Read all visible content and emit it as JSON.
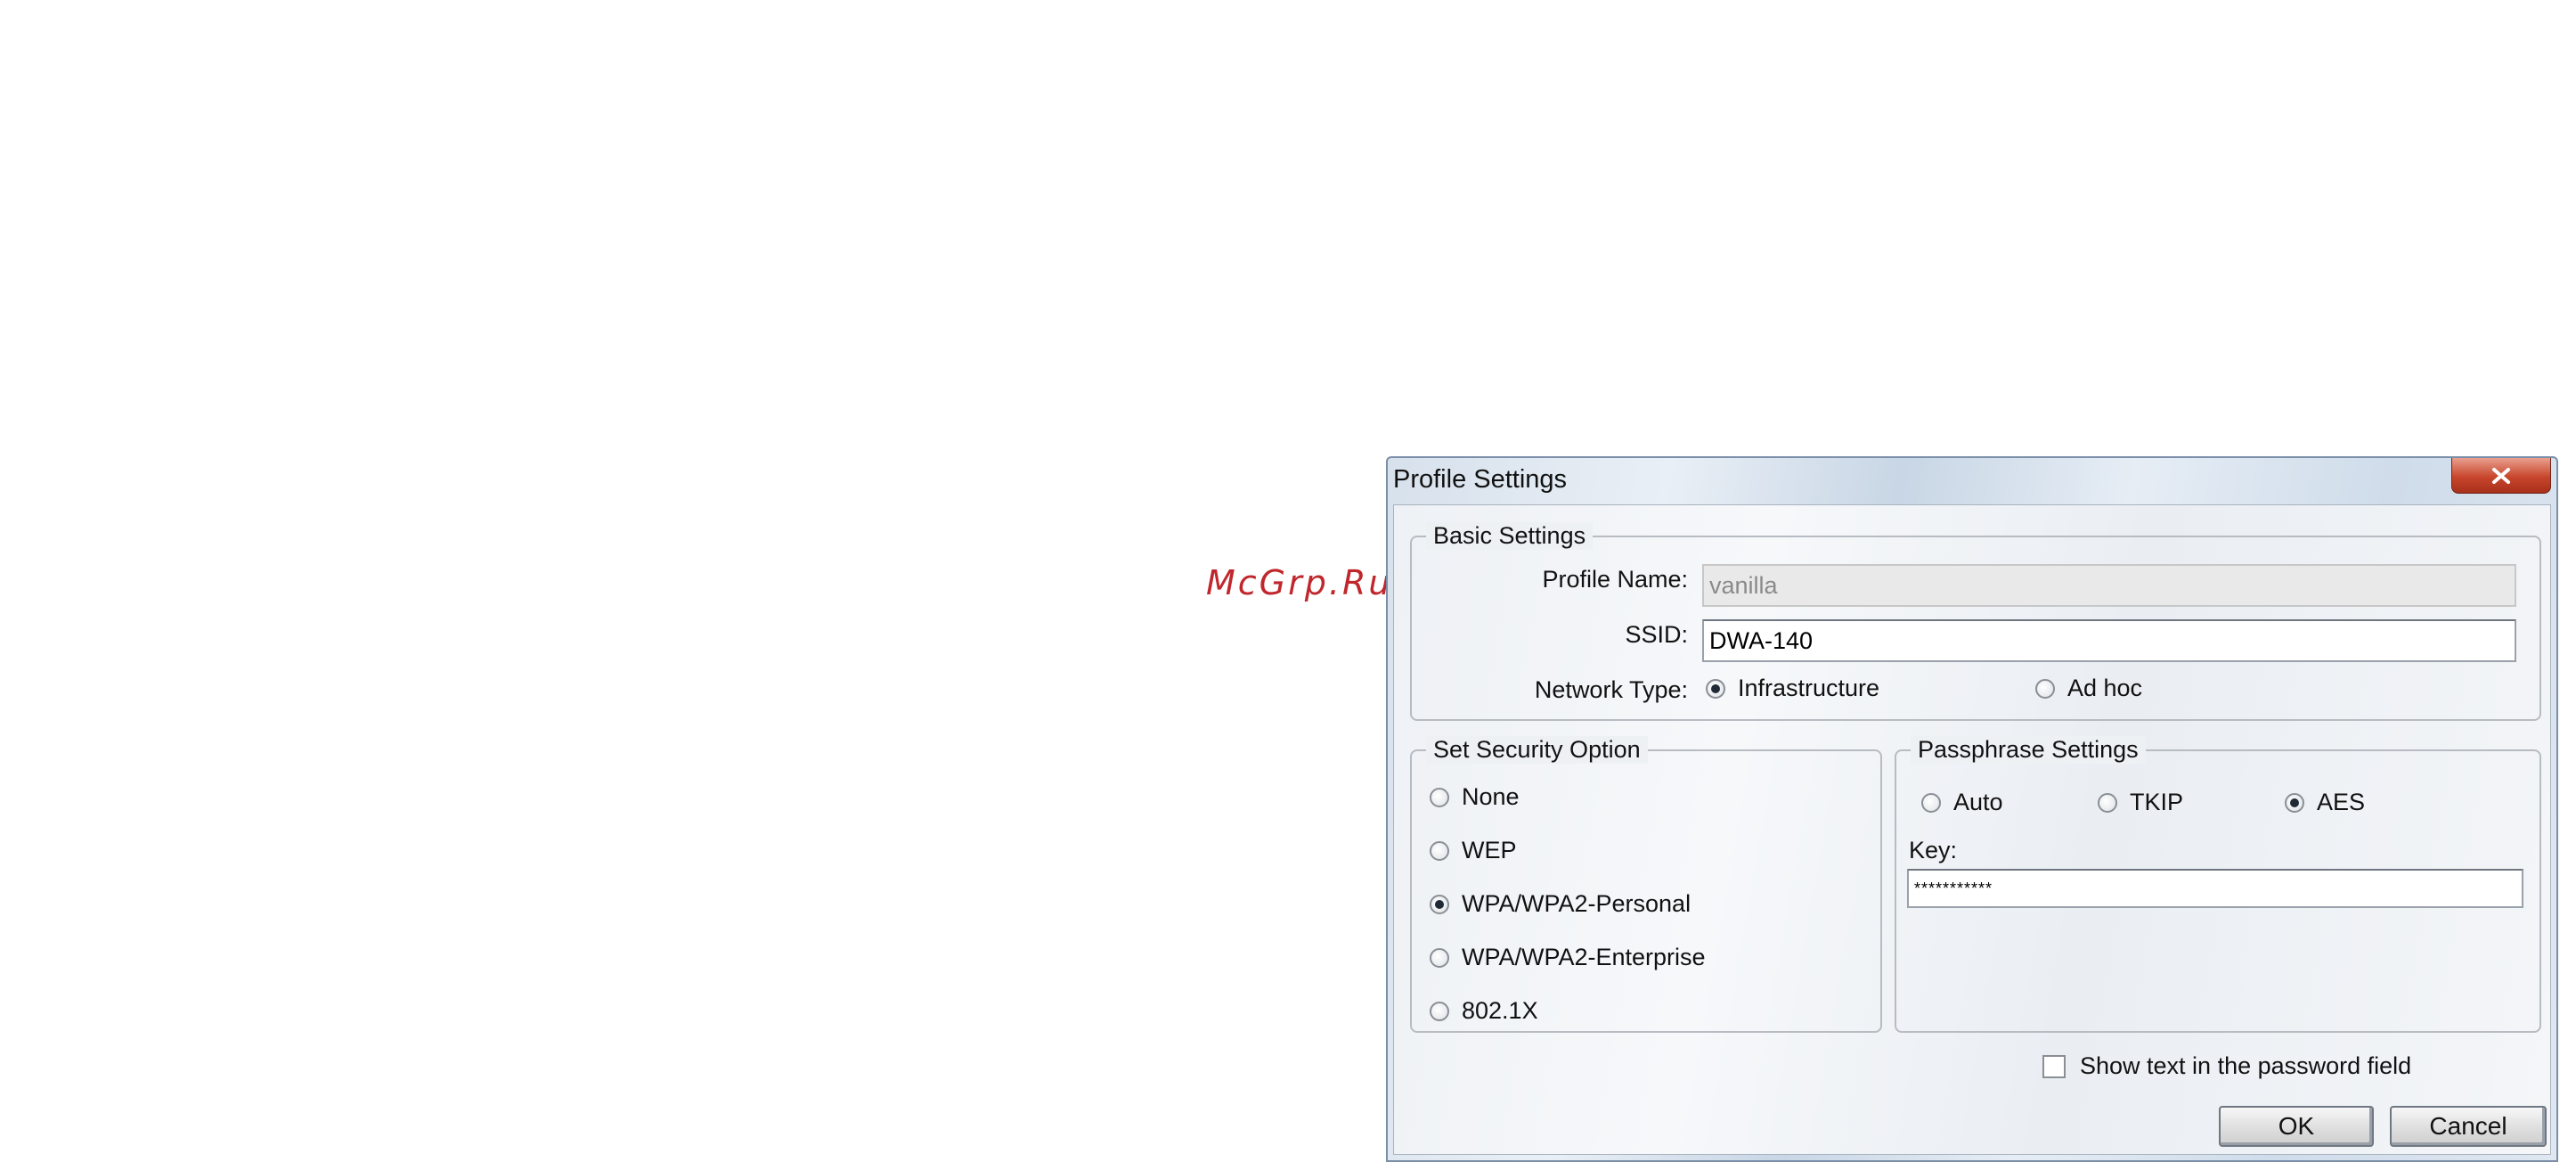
{
  "watermark": "McGrp.Ru",
  "window": {
    "title": "Profile Settings"
  },
  "basic": {
    "group_label": "Basic Settings",
    "profile_name_label": "Profile Name:",
    "profile_name_value": "vanilla",
    "ssid_label": "SSID:",
    "ssid_value": "DWA-140",
    "network_type_label": "Network Type:",
    "network_types": [
      {
        "label": "Infrastructure",
        "checked": true
      },
      {
        "label": "Ad hoc",
        "checked": false
      }
    ]
  },
  "security": {
    "group_label": "Set Security Option",
    "options": [
      {
        "label": "None",
        "checked": false
      },
      {
        "label": "WEP",
        "checked": false
      },
      {
        "label": "WPA/WPA2-Personal",
        "checked": true
      },
      {
        "label": "WPA/WPA2-Enterprise",
        "checked": false
      },
      {
        "label": "802.1X",
        "checked": false
      }
    ]
  },
  "passphrase": {
    "group_label": "Passphrase Settings",
    "ciphers": [
      {
        "label": "Auto",
        "checked": false
      },
      {
        "label": "TKIP",
        "checked": false
      },
      {
        "label": "AES",
        "checked": true
      }
    ],
    "key_label": "Key:",
    "key_value": "***********"
  },
  "show_text_label": "Show text in the password field",
  "buttons": {
    "ok": "OK",
    "cancel": "Cancel"
  },
  "icons": {
    "close": "close-icon"
  }
}
